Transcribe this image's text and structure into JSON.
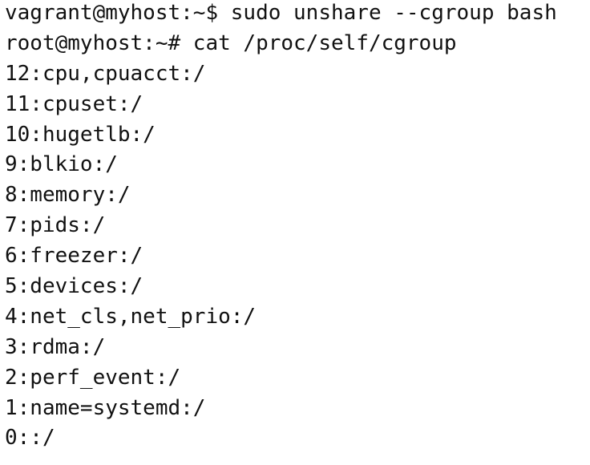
{
  "terminal": {
    "lines": [
      "vagrant@myhost:~$ sudo unshare --cgroup bash",
      "root@myhost:~# cat /proc/self/cgroup",
      "12:cpu,cpuacct:/",
      "11:cpuset:/",
      "10:hugetlb:/",
      "9:blkio:/",
      "8:memory:/",
      "7:pids:/",
      "6:freezer:/",
      "5:devices:/",
      "4:net_cls,net_prio:/",
      "3:rdma:/",
      "2:perf_event:/",
      "1:name=systemd:/",
      "0::/"
    ]
  }
}
